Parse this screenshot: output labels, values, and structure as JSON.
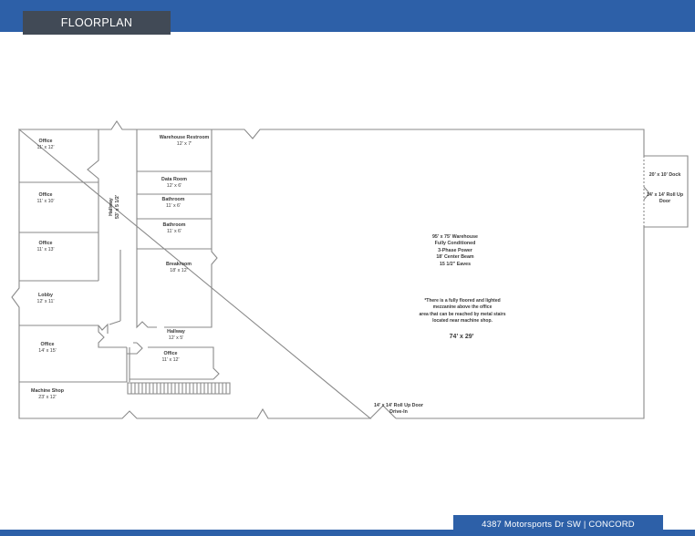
{
  "header": {
    "title": "FLOORPLAN"
  },
  "footer": {
    "address": "4387 Motorsports Dr SW | CONCORD"
  },
  "rooms": [
    {
      "name": "Office",
      "size": "11' x 12'"
    },
    {
      "name": "Office",
      "size": "11' x 10'"
    },
    {
      "name": "Office",
      "size": "11' x 13'"
    },
    {
      "name": "Lobby",
      "size": "12' x 11'"
    },
    {
      "name": "Office",
      "size": "14' x 15'"
    },
    {
      "name": "Machine Shop",
      "size": "23' x 12'"
    },
    {
      "name": "Hallway",
      "size": "53' x 5 1/2'"
    },
    {
      "name": "Warehouse Restroom",
      "size": "12' x 7'"
    },
    {
      "name": "Data Room",
      "size": "12' x 6'"
    },
    {
      "name": "Bathroom",
      "size": "11' x 6'"
    },
    {
      "name": "Bathroom",
      "size": "11' x 6'"
    },
    {
      "name": "Breakroom",
      "size": "18' x 12'"
    },
    {
      "name": "Hallway",
      "size": "12' x 5'"
    },
    {
      "name": "Office",
      "size": "11' x 12'"
    }
  ],
  "warehouse": {
    "lines": [
      "95' x 75' Warehouse",
      "Fully Conditioned",
      "3-Phase Power",
      "18' Center Beam",
      "15 1/2\" Eaves"
    ]
  },
  "mezzanine": {
    "lines": [
      "*There is a fully floored and lighted",
      "mezzanine above the office",
      "area that can be reached by metal stairs",
      "located near machine shop."
    ],
    "size": "74' x 29'"
  },
  "dock": {
    "label": "20' x 10' Dock"
  },
  "side_door": {
    "lines": [
      "14' x 14' Roll Up",
      "Door"
    ]
  },
  "drive_in": {
    "lines": [
      "14' x 14' Roll Up  Door",
      "Drive-In"
    ]
  }
}
